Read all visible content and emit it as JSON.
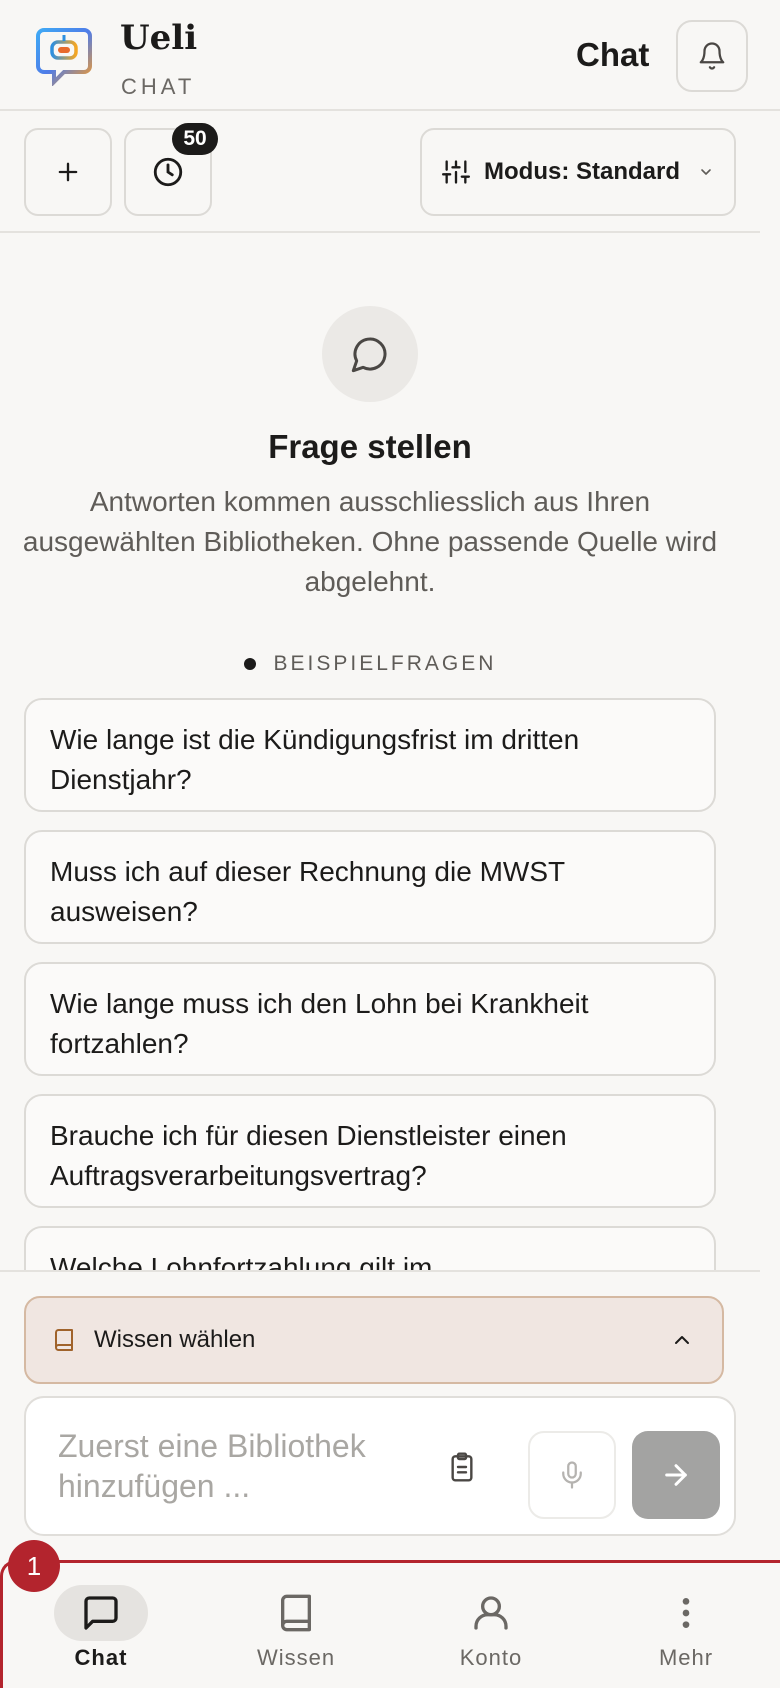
{
  "brand": {
    "name": "Ueli",
    "subtitle": "CHAT"
  },
  "header": {
    "title": "Chat"
  },
  "toolbar": {
    "history_count": "50",
    "mode_label": "Modus: Standard"
  },
  "empty_state": {
    "title": "Frage stellen",
    "description": "Antworten kommen ausschliesslich aus Ihren ausgewählten Bibliotheken. Ohne passende Quelle wird abgelehnt."
  },
  "examples": {
    "heading": "BEISPIELFRAGEN",
    "questions": [
      "Wie lange ist die Kündigungsfrist im dritten Dienstjahr?",
      "Muss ich auf dieser Rechnung die MWST ausweisen?",
      "Wie lange muss ich den Lohn bei Krankheit fortzahlen?",
      "Brauche ich für diesen Dienstleister einen Auftragsverarbeitungsvertrag?",
      "Welche Lohnfortzahlung gilt im"
    ]
  },
  "knowledge": {
    "label": "Wissen wählen"
  },
  "composer": {
    "placeholder": "Zuerst eine Bibliothek hinzufügen ..."
  },
  "nav": {
    "items": [
      {
        "label": "Chat",
        "icon": "chat-bubble-icon",
        "active": true
      },
      {
        "label": "Wissen",
        "icon": "book-icon",
        "active": false
      },
      {
        "label": "Konto",
        "icon": "user-icon",
        "active": false
      },
      {
        "label": "Mehr",
        "icon": "more-vertical-icon",
        "active": false
      }
    ],
    "notification_count": "1"
  },
  "colors": {
    "background": "#f8f7f5",
    "accent_red": "#b3242d",
    "knowledge_bg": "#f0e6e1",
    "knowledge_border": "#d5b9a2",
    "send_disabled": "#a3a3a2"
  }
}
